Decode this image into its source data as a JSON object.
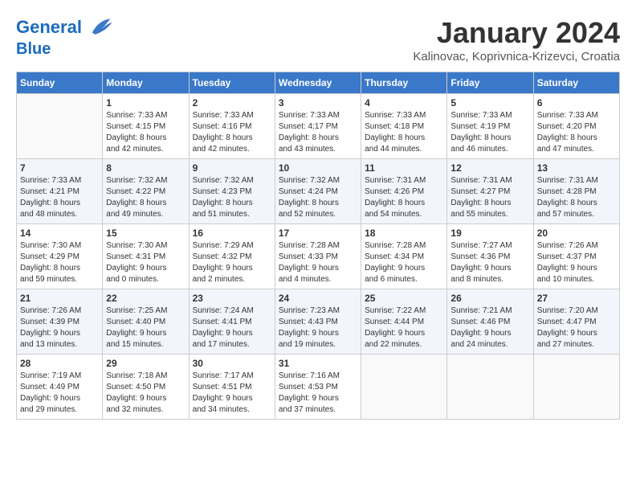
{
  "header": {
    "logo_line1": "General",
    "logo_line2": "Blue",
    "month": "January 2024",
    "location": "Kalinovac, Koprivnica-Krizevci, Croatia"
  },
  "days_of_week": [
    "Sunday",
    "Monday",
    "Tuesday",
    "Wednesday",
    "Thursday",
    "Friday",
    "Saturday"
  ],
  "weeks": [
    [
      {
        "day": "",
        "info": ""
      },
      {
        "day": "1",
        "info": "Sunrise: 7:33 AM\nSunset: 4:15 PM\nDaylight: 8 hours\nand 42 minutes."
      },
      {
        "day": "2",
        "info": "Sunrise: 7:33 AM\nSunset: 4:16 PM\nDaylight: 8 hours\nand 42 minutes."
      },
      {
        "day": "3",
        "info": "Sunrise: 7:33 AM\nSunset: 4:17 PM\nDaylight: 8 hours\nand 43 minutes."
      },
      {
        "day": "4",
        "info": "Sunrise: 7:33 AM\nSunset: 4:18 PM\nDaylight: 8 hours\nand 44 minutes."
      },
      {
        "day": "5",
        "info": "Sunrise: 7:33 AM\nSunset: 4:19 PM\nDaylight: 8 hours\nand 46 minutes."
      },
      {
        "day": "6",
        "info": "Sunrise: 7:33 AM\nSunset: 4:20 PM\nDaylight: 8 hours\nand 47 minutes."
      }
    ],
    [
      {
        "day": "7",
        "info": "Sunrise: 7:33 AM\nSunset: 4:21 PM\nDaylight: 8 hours\nand 48 minutes."
      },
      {
        "day": "8",
        "info": "Sunrise: 7:32 AM\nSunset: 4:22 PM\nDaylight: 8 hours\nand 49 minutes."
      },
      {
        "day": "9",
        "info": "Sunrise: 7:32 AM\nSunset: 4:23 PM\nDaylight: 8 hours\nand 51 minutes."
      },
      {
        "day": "10",
        "info": "Sunrise: 7:32 AM\nSunset: 4:24 PM\nDaylight: 8 hours\nand 52 minutes."
      },
      {
        "day": "11",
        "info": "Sunrise: 7:31 AM\nSunset: 4:26 PM\nDaylight: 8 hours\nand 54 minutes."
      },
      {
        "day": "12",
        "info": "Sunrise: 7:31 AM\nSunset: 4:27 PM\nDaylight: 8 hours\nand 55 minutes."
      },
      {
        "day": "13",
        "info": "Sunrise: 7:31 AM\nSunset: 4:28 PM\nDaylight: 8 hours\nand 57 minutes."
      }
    ],
    [
      {
        "day": "14",
        "info": "Sunrise: 7:30 AM\nSunset: 4:29 PM\nDaylight: 8 hours\nand 59 minutes."
      },
      {
        "day": "15",
        "info": "Sunrise: 7:30 AM\nSunset: 4:31 PM\nDaylight: 9 hours\nand 0 minutes."
      },
      {
        "day": "16",
        "info": "Sunrise: 7:29 AM\nSunset: 4:32 PM\nDaylight: 9 hours\nand 2 minutes."
      },
      {
        "day": "17",
        "info": "Sunrise: 7:28 AM\nSunset: 4:33 PM\nDaylight: 9 hours\nand 4 minutes."
      },
      {
        "day": "18",
        "info": "Sunrise: 7:28 AM\nSunset: 4:34 PM\nDaylight: 9 hours\nand 6 minutes."
      },
      {
        "day": "19",
        "info": "Sunrise: 7:27 AM\nSunset: 4:36 PM\nDaylight: 9 hours\nand 8 minutes."
      },
      {
        "day": "20",
        "info": "Sunrise: 7:26 AM\nSunset: 4:37 PM\nDaylight: 9 hours\nand 10 minutes."
      }
    ],
    [
      {
        "day": "21",
        "info": "Sunrise: 7:26 AM\nSunset: 4:39 PM\nDaylight: 9 hours\nand 13 minutes."
      },
      {
        "day": "22",
        "info": "Sunrise: 7:25 AM\nSunset: 4:40 PM\nDaylight: 9 hours\nand 15 minutes."
      },
      {
        "day": "23",
        "info": "Sunrise: 7:24 AM\nSunset: 4:41 PM\nDaylight: 9 hours\nand 17 minutes."
      },
      {
        "day": "24",
        "info": "Sunrise: 7:23 AM\nSunset: 4:43 PM\nDaylight: 9 hours\nand 19 minutes."
      },
      {
        "day": "25",
        "info": "Sunrise: 7:22 AM\nSunset: 4:44 PM\nDaylight: 9 hours\nand 22 minutes."
      },
      {
        "day": "26",
        "info": "Sunrise: 7:21 AM\nSunset: 4:46 PM\nDaylight: 9 hours\nand 24 minutes."
      },
      {
        "day": "27",
        "info": "Sunrise: 7:20 AM\nSunset: 4:47 PM\nDaylight: 9 hours\nand 27 minutes."
      }
    ],
    [
      {
        "day": "28",
        "info": "Sunrise: 7:19 AM\nSunset: 4:49 PM\nDaylight: 9 hours\nand 29 minutes."
      },
      {
        "day": "29",
        "info": "Sunrise: 7:18 AM\nSunset: 4:50 PM\nDaylight: 9 hours\nand 32 minutes."
      },
      {
        "day": "30",
        "info": "Sunrise: 7:17 AM\nSunset: 4:51 PM\nDaylight: 9 hours\nand 34 minutes."
      },
      {
        "day": "31",
        "info": "Sunrise: 7:16 AM\nSunset: 4:53 PM\nDaylight: 9 hours\nand 37 minutes."
      },
      {
        "day": "",
        "info": ""
      },
      {
        "day": "",
        "info": ""
      },
      {
        "day": "",
        "info": ""
      }
    ]
  ]
}
